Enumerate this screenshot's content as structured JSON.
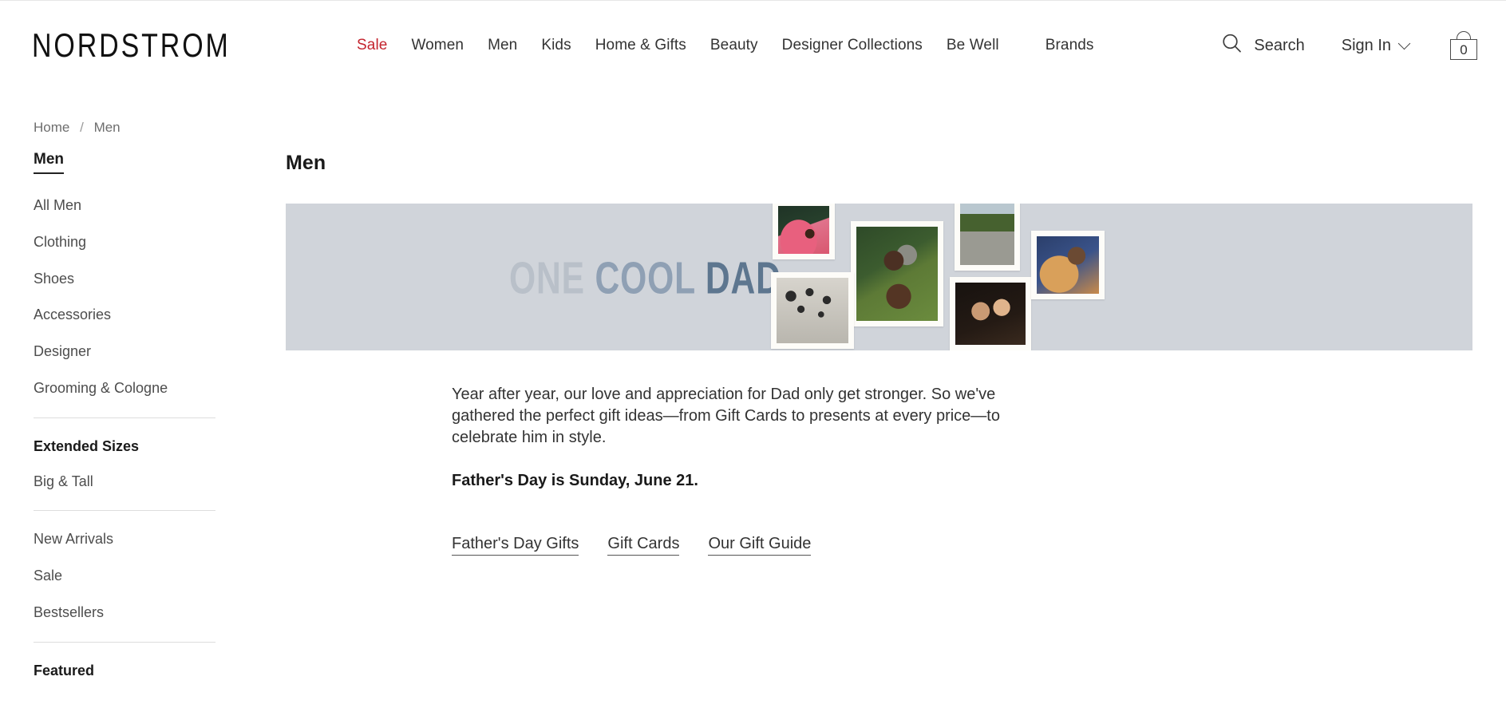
{
  "header": {
    "logo": "NORDSTROM",
    "nav": [
      {
        "label": "Sale",
        "accent": true
      },
      {
        "label": "Women",
        "accent": false
      },
      {
        "label": "Men",
        "accent": false
      },
      {
        "label": "Kids",
        "accent": false
      },
      {
        "label": "Home & Gifts",
        "accent": false
      },
      {
        "label": "Beauty",
        "accent": false
      },
      {
        "label": "Designer Collections",
        "accent": false
      },
      {
        "label": "Be Well",
        "accent": false
      },
      {
        "label": "Brands",
        "accent": false
      }
    ],
    "search_label": "Search",
    "signin_label": "Sign In",
    "bag_count": "0",
    "sale_color": "#c4242e"
  },
  "breadcrumb": {
    "home": "Home",
    "separator": "/",
    "current": "Men"
  },
  "sidebar": {
    "title": "Men",
    "group1": [
      "All Men",
      "Clothing",
      "Shoes",
      "Accessories",
      "Designer",
      "Grooming & Cologne"
    ],
    "extended_heading": "Extended Sizes",
    "group2": [
      "Big & Tall"
    ],
    "group3": [
      "New Arrivals",
      "Sale",
      "Bestsellers"
    ],
    "featured_heading": "Featured"
  },
  "main": {
    "page_title": "Men",
    "hero": {
      "word1": "ONE",
      "word2": "COOL",
      "word3": "DAD",
      "background_color": "#d0d4da",
      "word1_color": "#b9c0c9",
      "word2_color": "#8fa0b4",
      "word3_color": "#5d768f"
    },
    "paragraph": "Year after year, our love and appreciation for Dad only get stronger. So we've gathered the perfect gift ideas—from Gift Cards to presents at every price—to celebrate him in style.",
    "highlight": "Father's Day is Sunday, June 21.",
    "links": [
      "Father's Day Gifts",
      "Gift Cards",
      "Our Gift Guide"
    ]
  }
}
